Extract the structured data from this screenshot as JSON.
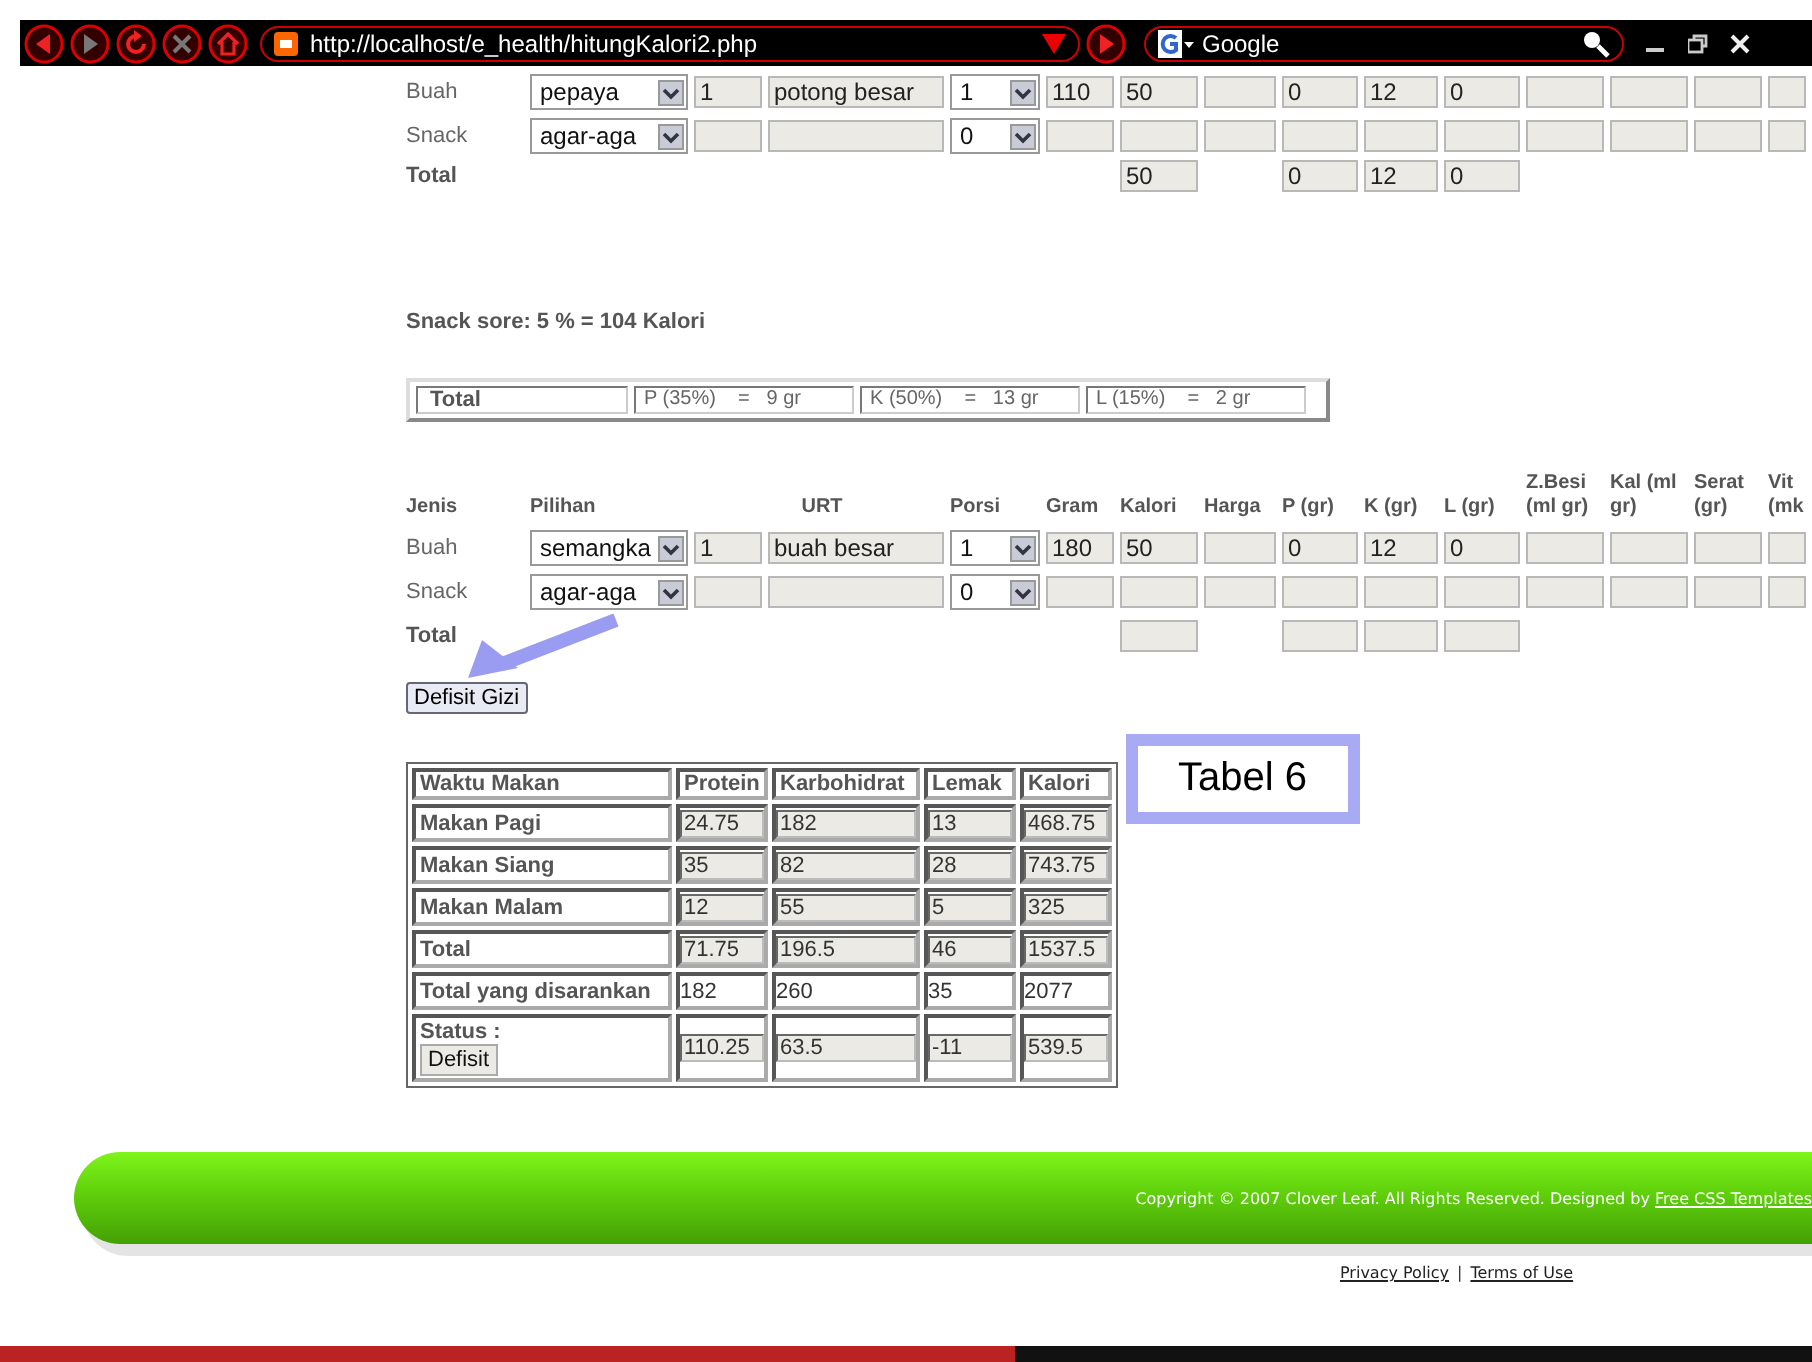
{
  "browser": {
    "url": "http://localhost/e_health/hitungKalori2.php",
    "search": "Google"
  },
  "meal_table_top": {
    "rows": [
      {
        "total": false,
        "cells": [
          {
            "kind": "label",
            "value": "Buah"
          },
          {
            "kind": "select",
            "value": "pepaya"
          },
          {
            "kind": "urt",
            "qty": "1",
            "value": "potong besar"
          },
          {
            "kind": "select",
            "value": "1"
          },
          {
            "kind": "field",
            "value": "110"
          },
          {
            "kind": "field",
            "value": "50"
          },
          {
            "kind": "field"
          },
          {
            "kind": "field",
            "value": "0"
          },
          {
            "kind": "field",
            "value": "12"
          },
          {
            "kind": "field",
            "value": "0"
          },
          {
            "kind": "field"
          },
          {
            "kind": "field"
          },
          {
            "kind": "field"
          },
          {
            "kind": "field"
          }
        ]
      },
      {
        "total": false,
        "cells": [
          {
            "kind": "label",
            "value": "Snack"
          },
          {
            "kind": "select",
            "value": "agar-aga"
          },
          {
            "kind": "urt"
          },
          {
            "kind": "select",
            "value": "0"
          },
          {
            "kind": "field"
          },
          {
            "kind": "field"
          },
          {
            "kind": "field"
          },
          {
            "kind": "field"
          },
          {
            "kind": "field"
          },
          {
            "kind": "field"
          },
          {
            "kind": "field"
          },
          {
            "kind": "field"
          },
          {
            "kind": "field"
          },
          {
            "kind": "field"
          }
        ]
      },
      {
        "total": true,
        "cells": [
          {
            "kind": "label",
            "value": "Total"
          },
          {
            "kind": "none"
          },
          {
            "kind": "none"
          },
          {
            "kind": "none"
          },
          {
            "kind": "none"
          },
          {
            "kind": "field",
            "value": "50"
          },
          {
            "kind": "none"
          },
          {
            "kind": "field",
            "value": "0"
          },
          {
            "kind": "field",
            "value": "12"
          },
          {
            "kind": "field",
            "value": "0"
          },
          {
            "kind": "none"
          },
          {
            "kind": "none"
          },
          {
            "kind": "none"
          },
          {
            "kind": "none"
          }
        ]
      }
    ]
  },
  "snack_note": "Snack sore: 5 % = 104 Kalori",
  "total_box": {
    "label": "Total",
    "items": [
      "P (35%)    =   9 gr",
      "K (50%)    =   13 gr",
      "L (15%)    =   2 gr"
    ]
  },
  "meal_table": {
    "columns": [
      "Jenis",
      "Pilihan",
      "URT",
      "Porsi",
      "Gram",
      "Kalori",
      "Harga",
      "P (gr)",
      "K (gr)",
      "L (gr)",
      "Z.Besi (ml gr)",
      "Kal (ml gr)",
      "Serat (gr)",
      "Vit (mk"
    ],
    "rows": [
      {
        "total": false,
        "cells": [
          {
            "kind": "label",
            "value": "Buah"
          },
          {
            "kind": "select",
            "value": "semangka"
          },
          {
            "kind": "urt",
            "qty": "1",
            "value": "buah besar"
          },
          {
            "kind": "select",
            "value": "1"
          },
          {
            "kind": "field",
            "value": "180"
          },
          {
            "kind": "field",
            "value": "50"
          },
          {
            "kind": "field"
          },
          {
            "kind": "field",
            "value": "0"
          },
          {
            "kind": "field",
            "value": "12"
          },
          {
            "kind": "field",
            "value": "0"
          },
          {
            "kind": "field"
          },
          {
            "kind": "field"
          },
          {
            "kind": "field"
          },
          {
            "kind": "field"
          }
        ]
      },
      {
        "total": false,
        "cells": [
          {
            "kind": "label",
            "value": "Snack"
          },
          {
            "kind": "select",
            "value": "agar-aga"
          },
          {
            "kind": "urt"
          },
          {
            "kind": "select",
            "value": "0"
          },
          {
            "kind": "field"
          },
          {
            "kind": "field"
          },
          {
            "kind": "field"
          },
          {
            "kind": "field"
          },
          {
            "kind": "field"
          },
          {
            "kind": "field"
          },
          {
            "kind": "field"
          },
          {
            "kind": "field"
          },
          {
            "kind": "field"
          },
          {
            "kind": "field"
          }
        ]
      },
      {
        "total": true,
        "cells": [
          {
            "kind": "label",
            "value": "Total"
          },
          {
            "kind": "none"
          },
          {
            "kind": "none"
          },
          {
            "kind": "none"
          },
          {
            "kind": "none"
          },
          {
            "kind": "field"
          },
          {
            "kind": "none"
          },
          {
            "kind": "field"
          },
          {
            "kind": "field"
          },
          {
            "kind": "field"
          },
          {
            "kind": "none"
          },
          {
            "kind": "none"
          },
          {
            "kind": "none"
          },
          {
            "kind": "none"
          }
        ]
      }
    ]
  },
  "button": "Defisit Gizi",
  "summary_table": {
    "columns": [
      "Waktu Makan",
      "Protein",
      "Karbohidrat",
      "Lemak",
      "Kalori"
    ],
    "rows": [
      {
        "label": "Makan Pagi",
        "kind": "computed",
        "values": [
          "24.75",
          "182",
          "13",
          "468.75"
        ]
      },
      {
        "label": "Makan Siang",
        "kind": "computed",
        "values": [
          "35",
          "82",
          "28",
          "743.75"
        ]
      },
      {
        "label": "Makan Malam",
        "kind": "computed",
        "values": [
          "12",
          "55",
          "5",
          "325"
        ]
      },
      {
        "label": "Total",
        "kind": "computed",
        "values": [
          "71.75",
          "196.5",
          "46",
          "1537.5"
        ]
      },
      {
        "label": "Total yang disarankan",
        "kind": "plain",
        "values": [
          "182",
          "260",
          "35",
          "2077"
        ]
      },
      {
        "label": "Status :",
        "kind": "status",
        "status": "Defisit",
        "values": [
          "110.25",
          "63.5",
          "-11",
          "539.5"
        ]
      }
    ]
  },
  "callout": "Tabel 6",
  "footer": {
    "copyright": "Copyright © 2007 Clover Leaf. All Rights Reserved. Designed by",
    "credit_link": "Free CSS Templates",
    "links": [
      "Privacy Policy",
      "Terms of Use"
    ],
    "separator": "|"
  }
}
